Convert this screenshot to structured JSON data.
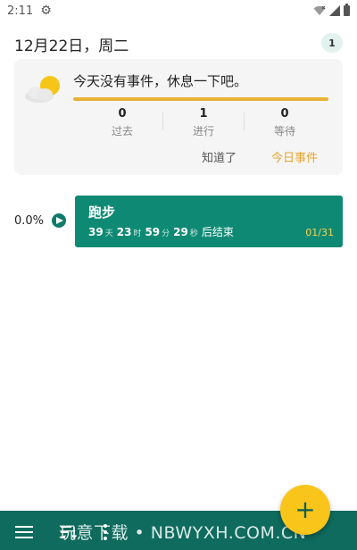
{
  "status_bar": {
    "time": "2:11",
    "settings_icon": "gear-icon",
    "wifi_icon": "wifi-icon",
    "signal_icon": "signal-icon",
    "battery_icon": "battery-icon"
  },
  "header": {
    "date": "12月22日，周二",
    "count": "1"
  },
  "summary": {
    "weather_icon": "partly-cloudy-icon",
    "message": "今天没有事件，休息一下吧。",
    "bar_color": "#e8b236",
    "stats": [
      {
        "value": "0",
        "label": "过去"
      },
      {
        "value": "1",
        "label": "进行"
      },
      {
        "value": "0",
        "label": "等待"
      }
    ],
    "ack_label": "知道了",
    "today_label": "今日事件"
  },
  "event": {
    "percent": "0.0%",
    "play_icon": "play-icon",
    "title": "跑步",
    "days": "39",
    "days_unit": "天",
    "hours": "23",
    "hours_unit": "时",
    "minutes": "59",
    "minutes_unit": "分",
    "seconds": "29",
    "seconds_unit": "秒",
    "suffix": "后结束",
    "progress": "01/31",
    "color": "#0e8a74"
  },
  "bottom_bar": {
    "menu_icon": "menu-icon",
    "sort_icon": "sort-icon",
    "more_icon": "more-vert-icon",
    "watermark": "玩意下载 • NBWYXH.COM.CN",
    "color": "#0e6b5e"
  },
  "fab": {
    "label": "+",
    "icon": "plus-icon",
    "color": "#f9c51b"
  }
}
